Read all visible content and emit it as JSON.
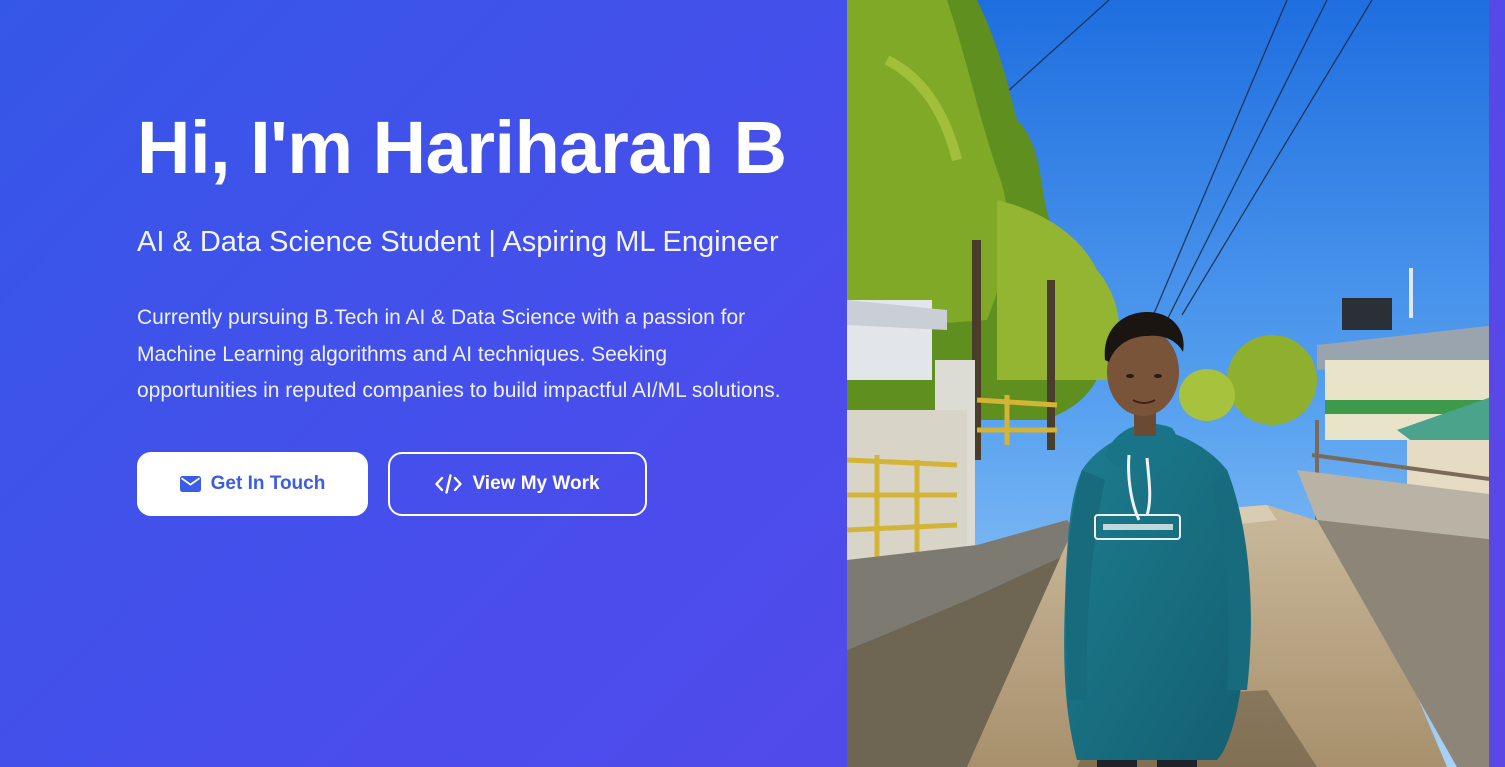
{
  "hero": {
    "title": "Hi, I'm Hariharan B",
    "subtitle": "AI & Data Science Student | Aspiring ML Engineer",
    "description": "Currently pursuing B.Tech in AI & Data Science with a passion for Machine Learning algorithms and AI techniques. Seeking opportunities in reputed companies to build impactful AI/ML solutions.",
    "buttons": {
      "contact": {
        "label": "Get In Touch",
        "icon": "envelope-icon"
      },
      "work": {
        "label": "View My Work",
        "icon": "code-icon"
      }
    }
  },
  "photo": {
    "alt": "Portrait of Hariharan B wearing a teal hoodie outdoors on a sunny path lined with trees"
  },
  "colors": {
    "gradient_start": "#3557e8",
    "gradient_end": "#5b47e6",
    "primary_button_text": "#3b5ce6",
    "text": "#ffffff"
  }
}
